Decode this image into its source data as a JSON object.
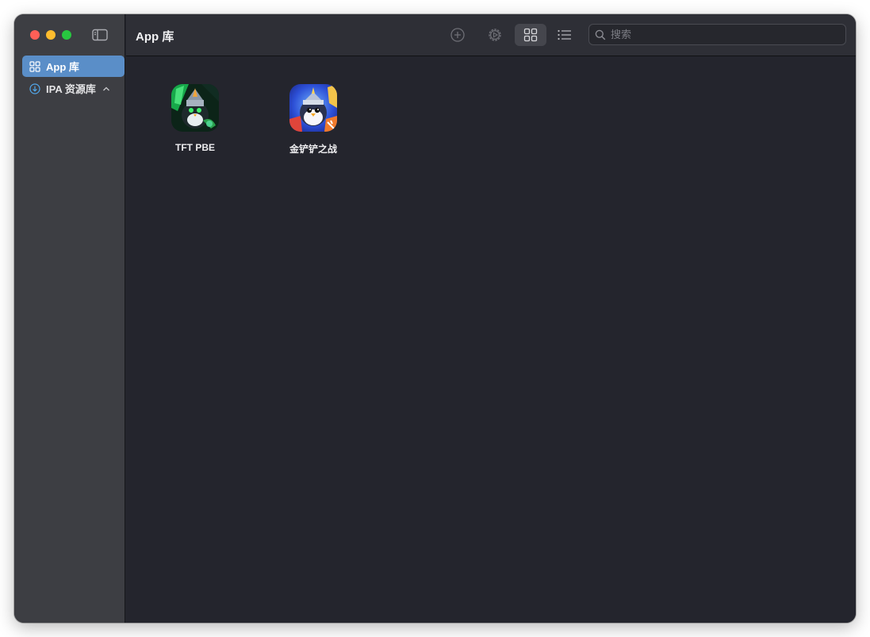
{
  "window": {
    "title": "App 库"
  },
  "sidebar": {
    "items": [
      {
        "label": "App 库",
        "icon": "grid-icon",
        "active": true
      },
      {
        "label": "IPA 资源库",
        "icon": "download-circle-icon",
        "expanded": true
      }
    ]
  },
  "toolbar": {
    "buttons": [
      "add-circle-icon",
      "gear-play-icon",
      "grid-view-icon",
      "list-view-icon"
    ],
    "selected_view": "grid",
    "search_placeholder": "搜索",
    "search_value": ""
  },
  "apps": [
    {
      "name": "TFT PBE",
      "icon": "tft-pbe-app-icon",
      "accent": "#1fae4a"
    },
    {
      "name": "金铲铲之战",
      "icon": "jcczz-app-icon",
      "accent": "#2f57d8"
    }
  ],
  "colors": {
    "accent": "#5a8ec8",
    "sidebar_bg": "#3d3e43",
    "content_bg": "#24252d"
  }
}
